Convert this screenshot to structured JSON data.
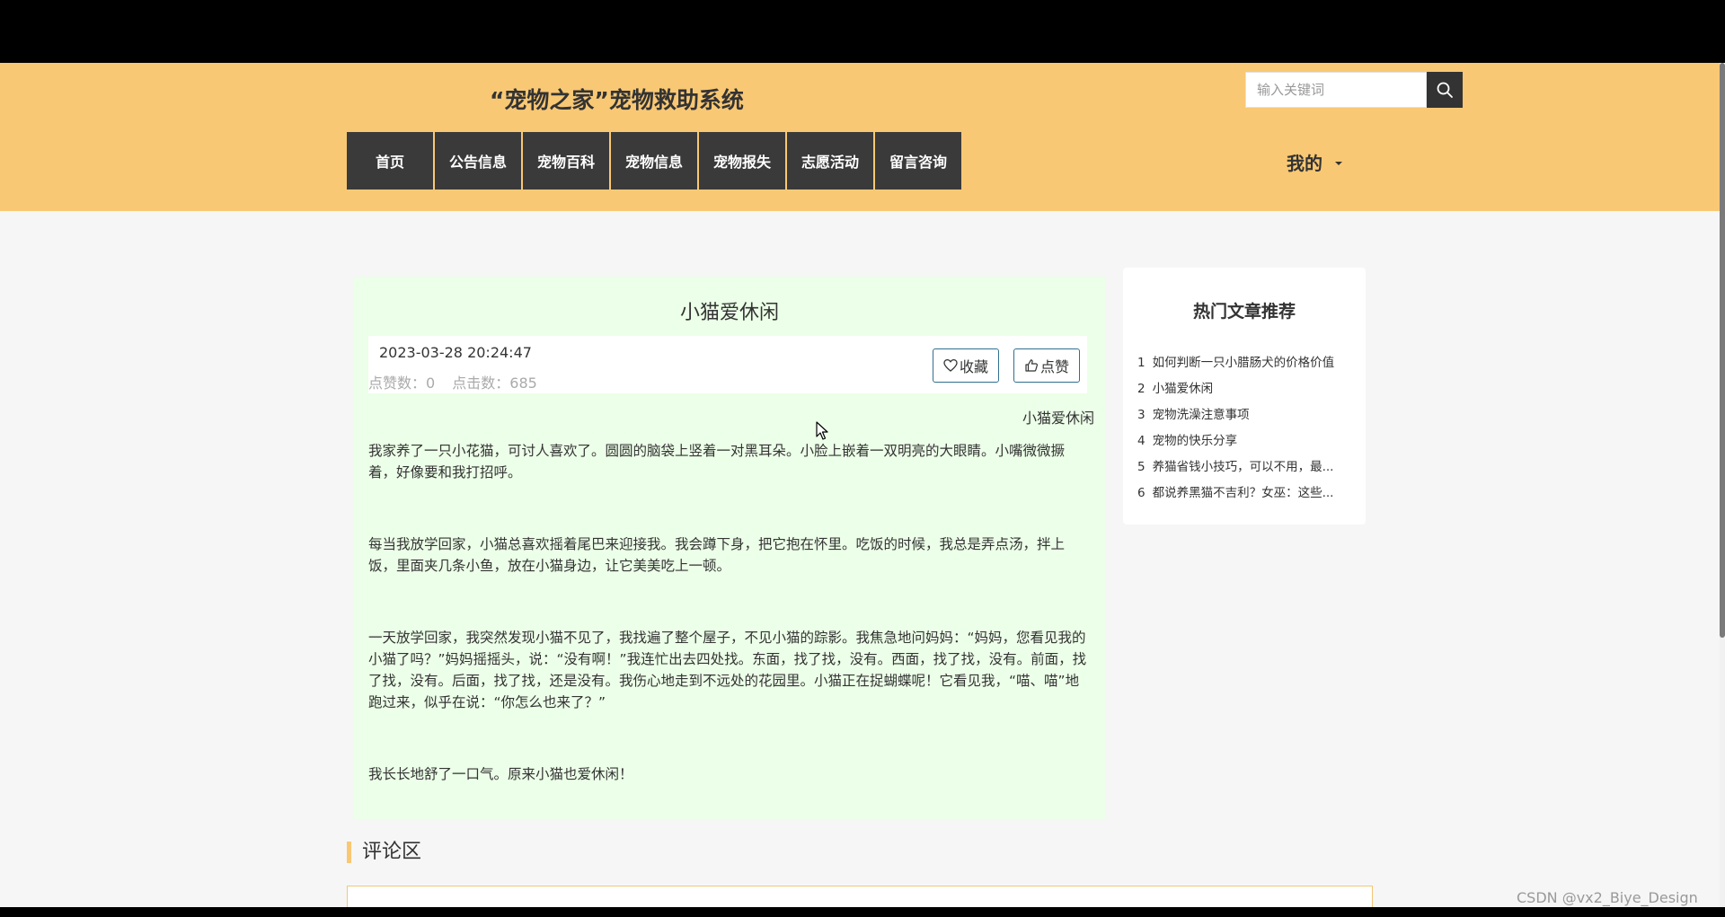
{
  "header": {
    "site_title": "“宠物之家”宠物救助系统",
    "search_placeholder": "输入关键词",
    "user_menu_label": "我的",
    "nav": [
      {
        "label": "首页"
      },
      {
        "label": "公告信息"
      },
      {
        "label": "宠物百科"
      },
      {
        "label": "宠物信息"
      },
      {
        "label": "宠物报失"
      },
      {
        "label": "志愿活动"
      },
      {
        "label": "留言咨询"
      }
    ]
  },
  "article": {
    "title": "小猫爱休闲",
    "date": "2023-03-28 20:24:47",
    "likes_text": "点赞数：0",
    "clicks_text": "点击数：685",
    "favorite_label": "收藏",
    "like_label": "点赞",
    "tag": "小猫爱休闲",
    "paragraphs": [
      "我家养了一只小花猫，可讨人喜欢了。圆圆的脑袋上竖着一对黑耳朵。小脸上嵌着一双明亮的大眼睛。小嘴微微撅着，好像要和我打招呼。",
      "每当我放学回家，小猫总喜欢摇着尾巴来迎接我。我会蹲下身，把它抱在怀里。吃饭的时候，我总是弄点汤，拌上饭，里面夹几条小鱼，放在小猫身边，让它美美吃上一顿。",
      "一天放学回家，我突然发现小猫不见了，我找遍了整个屋子，不见小猫的踪影。我焦急地问妈妈：“妈妈，您看见我的小猫了吗？”妈妈摇摇头，说：“没有啊！”我连忙出去四处找。东面，找了找，没有。西面，找了找，没有。前面，找了找，没有。后面，找了找，还是没有。我伤心地走到不远处的花园里。小猫正在捉蝴蝶呢！它看见我，“喵、喵”地跑过来，似乎在说：“你怎么也来了？”",
      "我长长地舒了一口气。原来小猫也爱休闲！"
    ]
  },
  "comments": {
    "heading": "评论区"
  },
  "sidebar": {
    "title": "热门文章推荐",
    "items": [
      {
        "num": "1",
        "label": "如何判断一只小腊肠犬的价格价值"
      },
      {
        "num": "2",
        "label": "小猫爱休闲"
      },
      {
        "num": "3",
        "label": "宠物洗澡注意事项"
      },
      {
        "num": "4",
        "label": "宠物的快乐分享"
      },
      {
        "num": "5",
        "label": "养猫省钱小技巧，可以不用，最..."
      },
      {
        "num": "6",
        "label": "都说养黑猫不吉利？女巫：这些..."
      }
    ]
  },
  "watermark": "CSDN @vx2_Biye_Design",
  "icons": {
    "search": "search-icon",
    "favorite": "heart-icon",
    "like": "thumbs-up-icon",
    "dropdown": "caret-down-icon"
  },
  "colors": {
    "header_bg": "#f9c874",
    "nav_bg": "#3a3a3a",
    "article_bg": "#ecffe8",
    "accent": "#f9c874",
    "button_border": "#2f6f8f"
  }
}
